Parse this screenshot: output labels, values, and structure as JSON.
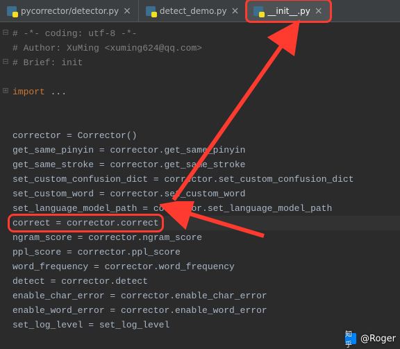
{
  "tabs": [
    {
      "label": "pycorrector/detector.py",
      "active": false,
      "highlighted": false
    },
    {
      "label": "detect_demo.py",
      "active": false,
      "highlighted": false
    },
    {
      "label": "__init__.py",
      "active": true,
      "highlighted": true
    }
  ],
  "code": {
    "comment1": "# -*- coding: utf-8 -*-",
    "comment2": "# Author: XuMing <xuming624@qq.com>",
    "comment3": "# Brief: init",
    "import_kw": "import",
    "import_rest": " ...",
    "assignments": [
      {
        "lhs": "corrector",
        "rhs": "Corrector()",
        "highlight": false
      },
      {
        "lhs": "get_same_pinyin",
        "rhs": "corrector.get_same_pinyin",
        "highlight": false
      },
      {
        "lhs": "get_same_stroke",
        "rhs": "corrector.get_same_stroke",
        "highlight": false
      },
      {
        "lhs": "set_custom_confusion_dict",
        "rhs": "corrector.set_custom_confusion_dict",
        "highlight": false
      },
      {
        "lhs": "set_custom_word",
        "rhs": "corrector.set_custom_word",
        "highlight": false
      },
      {
        "lhs": "set_language_model_path",
        "rhs": "corrector.set_language_model_path",
        "highlight": false
      },
      {
        "lhs": "correct",
        "rhs": "corrector.correct",
        "highlight": true
      },
      {
        "lhs": "ngram_score",
        "rhs": "corrector.ngram_score",
        "highlight": false
      },
      {
        "lhs": "ppl_score",
        "rhs": "corrector.ppl_score",
        "highlight": false
      },
      {
        "lhs": "word_frequency",
        "rhs": "corrector.word_frequency",
        "highlight": false
      },
      {
        "lhs": "detect",
        "rhs": "corrector.detect",
        "highlight": false
      },
      {
        "lhs": "enable_char_error",
        "rhs": "corrector.enable_char_error",
        "highlight": false
      },
      {
        "lhs": "enable_word_error",
        "rhs": "corrector.enable_word_error",
        "highlight": false
      },
      {
        "lhs": "set_log_level",
        "rhs": "set_log_level",
        "highlight": false
      }
    ]
  },
  "watermark": {
    "text": "@Roger",
    "icon_text": "知乎"
  }
}
